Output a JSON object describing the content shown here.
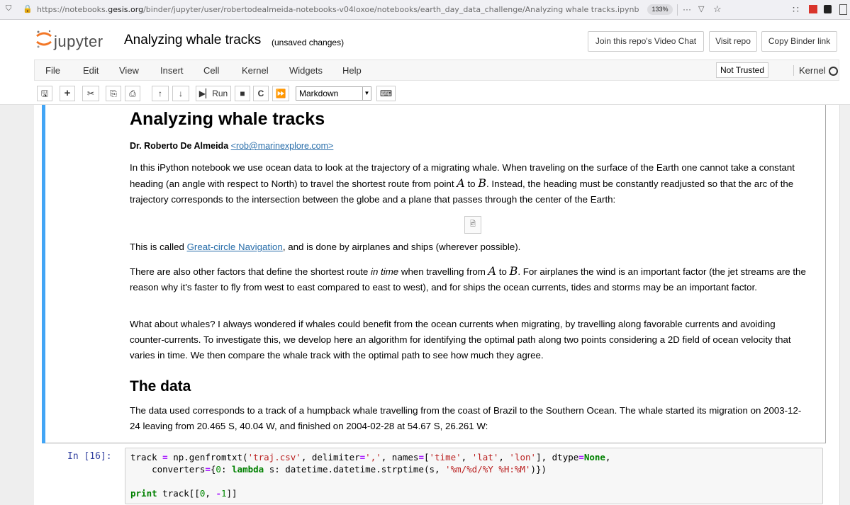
{
  "browser": {
    "url_prefix": "https://notebooks.",
    "url_domain": "gesis.org",
    "url_path": "/binder/jupyter/user/robertodealmeida-notebooks-v04loxoe/notebooks/earth_day_data_challenge/Analyzing whale tracks.ipynb",
    "zoom": "133%",
    "more": "···"
  },
  "header": {
    "logo_text": "jupyter",
    "notebook_title": "Analyzing whale tracks",
    "save_status": "(unsaved changes)",
    "video_chat": "Join this repo's Video Chat",
    "visit_repo": "Visit repo",
    "copy_binder": "Copy Binder link"
  },
  "menu": {
    "file": "File",
    "edit": "Edit",
    "view": "View",
    "insert": "Insert",
    "cell": "Cell",
    "kernel": "Kernel",
    "widgets": "Widgets",
    "help": "Help",
    "not_trusted": "Not Trusted",
    "kernel_status": "Kernel"
  },
  "toolbar": {
    "run_label": "Run",
    "cell_type": "Markdown"
  },
  "notebook": {
    "h1": "Analyzing whale tracks",
    "author": "Dr. Roberto De Almeida",
    "email": "<rob@marinexplore.com>",
    "p1_a": "In this iPython notebook we use ocean data to look at the trajectory of a migrating whale. When traveling on the surface of the Earth one cannot take a constant heading (an angle with respect to North) to travel the shortest route from point ",
    "var_a": "A",
    "p1_to": " to ",
    "var_b": "B",
    "p1_b": ". Instead, the heading must be constantly readjusted so that the arc of the trajectory corresponds to the intersection between the globe and a plane that passes through the center of the Earth:",
    "p2_a": "This is called ",
    "p2_link": "Great-circle Navigation",
    "p2_b": ", and is done by airplanes and ships (wherever possible).",
    "p3_a": "There are also other factors that define the shortest route ",
    "p3_em": "in time",
    "p3_b": " when travelling from ",
    "p3_c": ". For airplanes the wind is an important factor (the jet streams are the reason why it's faster to fly from west to east compared to east to west), and for ships the ocean currents, tides and storms may be an important factor.",
    "p4": "What about whales? I always wondered if whales could benefit from the ocean currents when migrating, by travelling along favorable currents and avoiding counter-currents. To investigate this, we develop here an algorithm for identifying the optimal path along two points considering a 2D field of ocean velocity that varies in time. We then compare the whale track with the optimal path to see how much they agree.",
    "h2": "The data",
    "p5": "The data used corresponds to a track of a humpback whale travelling from the coast of Brazil to the Southern Ocean. The whale started its migration on 2003-12-24 leaving from 20.465 S, 40.04 W, and finished on 2004-02-28 at 54.67 S, 26.261 W:",
    "prompt": "In [16]:"
  }
}
